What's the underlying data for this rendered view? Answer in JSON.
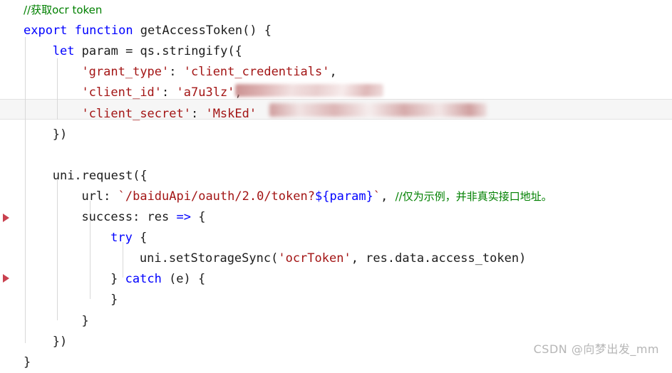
{
  "editor": {
    "language": "javascript",
    "theme_background": "#ffffff",
    "colors": {
      "keyword": "#0000FF",
      "string": "#A31515",
      "comment": "#008000",
      "plain_text": "#1C1C1C",
      "indent_guide": "#D8D8D8",
      "current_line_background": "#F6F6F6",
      "current_line_border": "#E2E2E2",
      "breakpoint_marker": "#C9414F",
      "watermark": "#B6B6B6"
    },
    "current_line_number": 6
  },
  "gutter": {
    "markers": [
      {
        "name": "fold-marker-success",
        "glyph": "triangle-right",
        "line": 11
      },
      {
        "name": "fold-marker-catch",
        "glyph": "triangle-right",
        "line": 14
      }
    ]
  },
  "code": {
    "lines": [
      {
        "n": 1,
        "indent": "",
        "tokens": [
          {
            "t": "comment",
            "text": "//获取ocr token"
          }
        ]
      },
      {
        "n": 2,
        "indent": "",
        "tokens": [
          {
            "t": "keyword",
            "text": "export"
          },
          {
            "t": "plain",
            "text": " "
          },
          {
            "t": "keyword",
            "text": "function"
          },
          {
            "t": "plain",
            "text": " getAccessToken() {"
          }
        ]
      },
      {
        "n": 3,
        "indent": "    ",
        "tokens": [
          {
            "t": "keyword",
            "text": "let"
          },
          {
            "t": "plain",
            "text": " param = qs.stringify({"
          }
        ]
      },
      {
        "n": 4,
        "indent": "        ",
        "tokens": [
          {
            "t": "string",
            "text": "'grant_type'"
          },
          {
            "t": "plain",
            "text": ": "
          },
          {
            "t": "string",
            "text": "'client_credentials'"
          },
          {
            "t": "plain",
            "text": ","
          }
        ]
      },
      {
        "n": 5,
        "indent": "        ",
        "tokens": [
          {
            "t": "string",
            "text": "'client_id'"
          },
          {
            "t": "plain",
            "text": ": "
          },
          {
            "t": "string",
            "text": "'a"
          },
          {
            "t": "redacted",
            "text": ""
          },
          {
            "t": "string",
            "text": "7u3lz'"
          },
          {
            "t": "plain",
            "text": ","
          }
        ]
      },
      {
        "n": 6,
        "indent": "        ",
        "current": true,
        "tokens": [
          {
            "t": "string",
            "text": "'client_secret'"
          },
          {
            "t": "plain",
            "text": ": "
          },
          {
            "t": "string",
            "text": "'Ms"
          },
          {
            "t": "redacted",
            "text": ""
          },
          {
            "t": "string",
            "text": "kEd'"
          }
        ]
      },
      {
        "n": 7,
        "indent": "    ",
        "tokens": [
          {
            "t": "plain",
            "text": "})"
          }
        ]
      },
      {
        "n": 8,
        "indent": "",
        "tokens": []
      },
      {
        "n": 9,
        "indent": "    ",
        "tokens": [
          {
            "t": "plain",
            "text": "uni.request({"
          }
        ]
      },
      {
        "n": 10,
        "indent": "        ",
        "tokens": [
          {
            "t": "plain",
            "text": "url: "
          },
          {
            "t": "template",
            "text": "`/baiduApi/oauth/2.0/token?"
          },
          {
            "t": "template-var",
            "text": "${param}"
          },
          {
            "t": "template",
            "text": "`"
          },
          {
            "t": "plain",
            "text": ", "
          },
          {
            "t": "comment",
            "text": "//仅为示例，并非真实接口地址。"
          }
        ]
      },
      {
        "n": 11,
        "indent": "        ",
        "tokens": [
          {
            "t": "plain",
            "text": "success: res "
          },
          {
            "t": "keyword",
            "text": "=>"
          },
          {
            "t": "plain",
            "text": " {"
          }
        ]
      },
      {
        "n": 12,
        "indent": "            ",
        "tokens": [
          {
            "t": "keyword",
            "text": "try"
          },
          {
            "t": "plain",
            "text": " {"
          }
        ]
      },
      {
        "n": 13,
        "indent": "                ",
        "tokens": [
          {
            "t": "plain",
            "text": "uni.setStorageSync("
          },
          {
            "t": "string",
            "text": "'ocrToken'"
          },
          {
            "t": "plain",
            "text": ", res.data.access_token)"
          }
        ]
      },
      {
        "n": 14,
        "indent": "            ",
        "tokens": [
          {
            "t": "plain",
            "text": "} "
          },
          {
            "t": "keyword",
            "text": "catch"
          },
          {
            "t": "plain",
            "text": " (e) {"
          }
        ]
      },
      {
        "n": 15,
        "indent": "            ",
        "tokens": [
          {
            "t": "plain",
            "text": "}"
          }
        ]
      },
      {
        "n": 16,
        "indent": "        ",
        "tokens": [
          {
            "t": "plain",
            "text": "}"
          }
        ]
      },
      {
        "n": 17,
        "indent": "    ",
        "tokens": [
          {
            "t": "plain",
            "text": "})"
          }
        ]
      },
      {
        "n": 18,
        "indent": "",
        "tokens": [
          {
            "t": "plain",
            "text": "}"
          }
        ]
      }
    ]
  },
  "watermark": {
    "text": "CSDN @向梦出发_mm"
  }
}
